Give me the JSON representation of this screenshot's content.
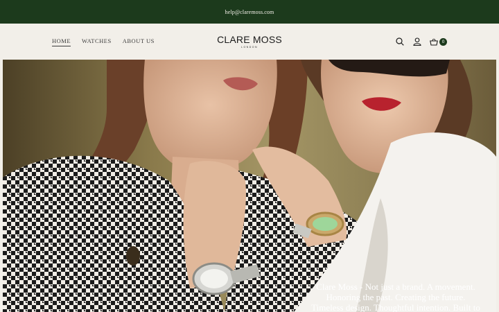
{
  "topbar": {
    "email": "help@claremoss.com"
  },
  "nav": {
    "items": [
      "HOME",
      "WATCHES",
      "ABOUT US"
    ]
  },
  "logo": {
    "name": "CLARE MOSS",
    "sub": "LONDON"
  },
  "cart": {
    "count": "0"
  },
  "icons": [
    "search-icon",
    "account-icon",
    "basket-icon"
  ],
  "hero": {
    "lines": [
      "Clare Moss - Not just a brand. A movement.",
      "Honoring the past. Creating the future.",
      "Timeless design. Thoughtful intention. Built to"
    ]
  },
  "colors": {
    "topbar": "#1c3a1c",
    "header": "#f2efe9"
  }
}
